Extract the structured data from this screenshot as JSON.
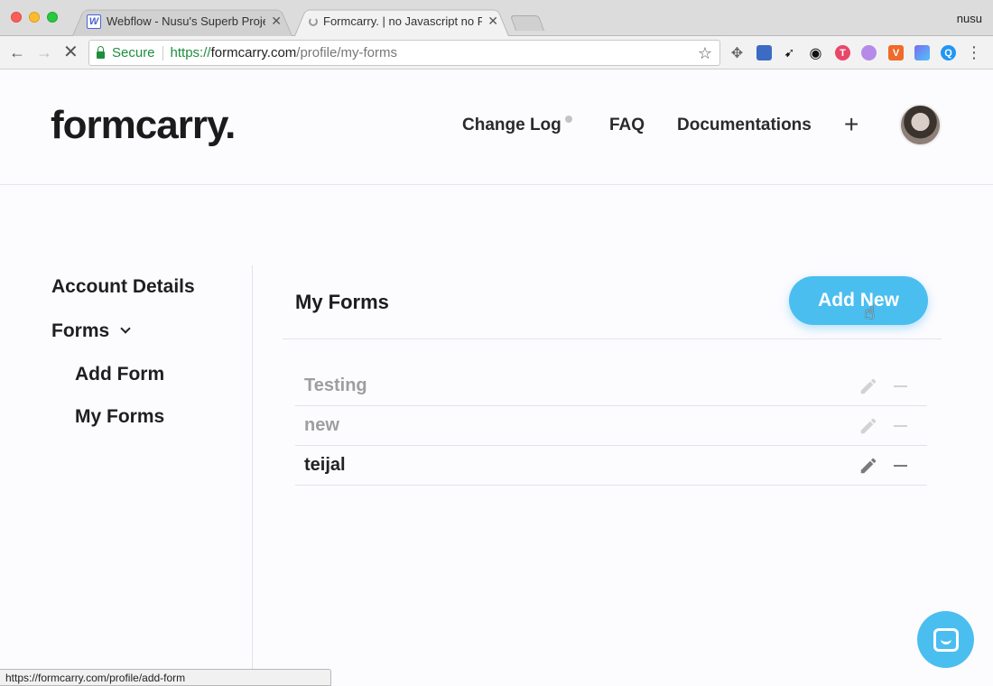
{
  "browser": {
    "tabs": [
      {
        "title": "Webflow - Nusu's Superb Proje",
        "favicon": "webflow-W-icon",
        "close": "✕"
      },
      {
        "title": "Formcarry. | no Javascript no F",
        "favicon": "loading-spinner",
        "close": "✕"
      }
    ],
    "profile": "nusu",
    "secure_label": "Secure",
    "url": {
      "scheme": "https://",
      "host": "formcarry.com",
      "path": "/profile/my-forms"
    },
    "status_url": "https://formcarry.com/profile/add-form"
  },
  "site": {
    "logo": "formcarry.",
    "nav": {
      "changelog": "Change Log",
      "faq": "FAQ",
      "docs": "Documentations",
      "plus": "+"
    }
  },
  "sidebar": {
    "account": "Account Details",
    "forms": "Forms",
    "add_form": "Add Form",
    "my_forms": "My Forms"
  },
  "main": {
    "title": "My Forms",
    "add_button": "Add New",
    "forms": [
      {
        "name": "Testing",
        "state": "dim"
      },
      {
        "name": "new",
        "state": "dim"
      },
      {
        "name": "teijal",
        "state": "active"
      }
    ]
  },
  "colors": {
    "accent": "#4bbef0"
  }
}
